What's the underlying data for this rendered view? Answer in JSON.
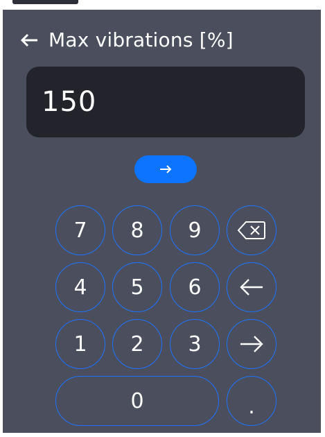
{
  "header": {
    "title": "Max vibrations [%]",
    "back_icon": "left-arrow-icon"
  },
  "display": {
    "value": "150"
  },
  "enter_button": {
    "icon": "right-arrow-icon",
    "color": "#0d74ff"
  },
  "keypad": {
    "keys": [
      "7",
      "8",
      "9",
      "4",
      "5",
      "6",
      "1",
      "2",
      "3",
      "0",
      "."
    ],
    "function_keys": [
      "backspace-icon",
      "left-arrow-icon",
      "right-arrow-icon"
    ],
    "accent": "#1f74ff"
  },
  "colors": {
    "panel_bg": "#4b4e5c",
    "display_bg": "#22232b",
    "text": "#ffffff"
  }
}
